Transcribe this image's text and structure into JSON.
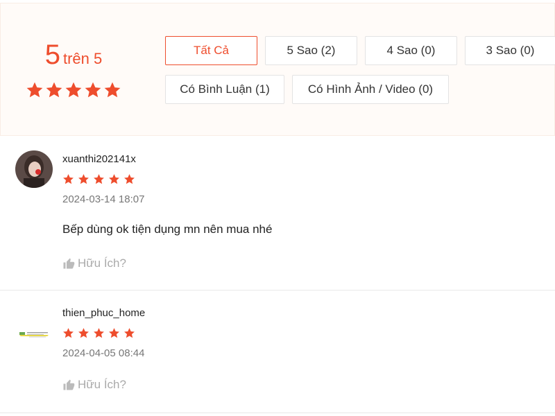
{
  "summary": {
    "score": "5",
    "score_suffix": "trên 5",
    "star_count": 5
  },
  "filters": [
    {
      "label": "Tất Cả",
      "active": true
    },
    {
      "label": "5 Sao (2)",
      "active": false
    },
    {
      "label": "4 Sao (0)",
      "active": false
    },
    {
      "label": "3 Sao (0)",
      "active": false
    },
    {
      "label": "Có Bình Luận (1)",
      "active": false
    },
    {
      "label": "Có Hình Ảnh / Video (0)",
      "active": false
    }
  ],
  "reviews": [
    {
      "username": "xuanthi202141x",
      "rating": 5,
      "time": "2024-03-14 18:07",
      "content": "Bếp dùng ok tiện dụng mn nên mua nhé",
      "helpful_label": "Hữu Ích?"
    },
    {
      "username": "thien_phuc_home",
      "rating": 5,
      "time": "2024-04-05 08:44",
      "content": "",
      "helpful_label": "Hữu Ích?"
    }
  ],
  "colors": {
    "accent": "#ee4d2d",
    "summary_bg": "#fffbf8",
    "muted": "#aaaaaa"
  },
  "icons": {
    "star": "star-icon",
    "thumbs_up": "thumbs-up-icon"
  }
}
